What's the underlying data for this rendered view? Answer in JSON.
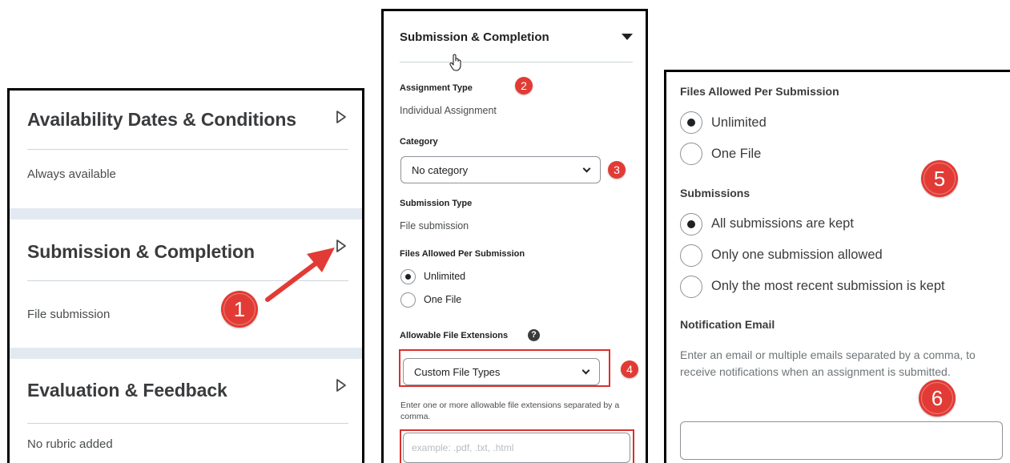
{
  "panel1": {
    "sections": [
      {
        "title": "Availability Dates & Conditions",
        "summary": "Always available"
      },
      {
        "title": "Submission & Completion",
        "summary": "File submission"
      },
      {
        "title": "Evaluation & Feedback",
        "summary": "No rubric added"
      }
    ]
  },
  "panel2": {
    "title": "Submission & Completion",
    "assignment_type_label": "Assignment Type",
    "assignment_type_value": "Individual Assignment",
    "category_label": "Category",
    "category_value": "No category",
    "submission_type_label": "Submission Type",
    "submission_type_value": "File submission",
    "files_allowed_label": "Files Allowed Per Submission",
    "files_allowed_options": [
      {
        "label": "Unlimited",
        "selected": true
      },
      {
        "label": "One File",
        "selected": false
      }
    ],
    "extensions_label": "Allowable File Extensions",
    "help_glyph": "?",
    "extensions_value": "Custom File Types",
    "extensions_hint": "Enter one or more allowable file extensions separated by a comma.",
    "extensions_placeholder": "example: .pdf, .txt, .html"
  },
  "panel3": {
    "files_allowed_label": "Files Allowed Per Submission",
    "files_allowed_options": [
      {
        "label": "Unlimited",
        "selected": true
      },
      {
        "label": "One File",
        "selected": false
      }
    ],
    "submissions_label": "Submissions",
    "submissions_options": [
      {
        "label": "All submissions are kept",
        "selected": true
      },
      {
        "label": "Only one submission allowed",
        "selected": false
      },
      {
        "label": "Only the most recent submission is kept",
        "selected": false
      }
    ],
    "notification_label": "Notification Email",
    "notification_desc": "Enter an email or multiple emails separated by a comma, to receive notifications when an assignment is submitted.",
    "notification_value": ""
  },
  "callouts": [
    "1",
    "2",
    "3",
    "4",
    "5",
    "6"
  ],
  "colors": {
    "callout": "#e23b35",
    "highlight": "#d9302f",
    "band": "#e3e9f1"
  }
}
